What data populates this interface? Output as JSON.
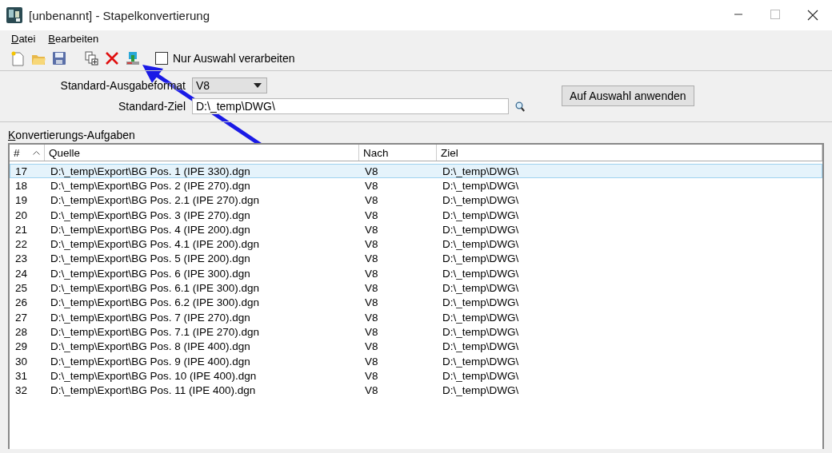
{
  "window": {
    "title": "[unbenannt] - Stapelkonvertierung"
  },
  "menu": [
    {
      "label": "Datei"
    },
    {
      "label": "Bearbeiten"
    }
  ],
  "toolbar": {
    "process_selection_only": {
      "label": "Nur Auswahl verarbeiten",
      "checked": false
    }
  },
  "settings": {
    "format_label": "Standard-Ausgabeformat",
    "format_value": "V8",
    "target_label": "Standard-Ziel",
    "target_value": "D:\\_temp\\DWG\\",
    "apply_button": "Auf Auswahl anwenden"
  },
  "tasks": {
    "title": "Konvertierungs-Aufgaben",
    "columns": [
      "#",
      "Quelle",
      "Nach",
      "Ziel"
    ],
    "rows": [
      {
        "cells": [
          "17",
          "D:\\_temp\\Export\\BG Pos. 1 (IPE 330).dgn",
          "V8",
          "D:\\_temp\\DWG\\"
        ],
        "selected": true
      },
      {
        "cells": [
          "18",
          "D:\\_temp\\Export\\BG Pos. 2 (IPE 270).dgn",
          "V8",
          "D:\\_temp\\DWG\\"
        ],
        "selected": false
      },
      {
        "cells": [
          "19",
          "D:\\_temp\\Export\\BG Pos. 2.1 (IPE 270).dgn",
          "V8",
          "D:\\_temp\\DWG\\"
        ],
        "selected": false
      },
      {
        "cells": [
          "20",
          "D:\\_temp\\Export\\BG Pos. 3 (IPE 270).dgn",
          "V8",
          "D:\\_temp\\DWG\\"
        ],
        "selected": false
      },
      {
        "cells": [
          "21",
          "D:\\_temp\\Export\\BG Pos. 4 (IPE 200).dgn",
          "V8",
          "D:\\_temp\\DWG\\"
        ],
        "selected": false
      },
      {
        "cells": [
          "22",
          "D:\\_temp\\Export\\BG Pos. 4.1 (IPE 200).dgn",
          "V8",
          "D:\\_temp\\DWG\\"
        ],
        "selected": false
      },
      {
        "cells": [
          "23",
          "D:\\_temp\\Export\\BG Pos. 5 (IPE 200).dgn",
          "V8",
          "D:\\_temp\\DWG\\"
        ],
        "selected": false
      },
      {
        "cells": [
          "24",
          "D:\\_temp\\Export\\BG Pos. 6 (IPE 300).dgn",
          "V8",
          "D:\\_temp\\DWG\\"
        ],
        "selected": false
      },
      {
        "cells": [
          "25",
          "D:\\_temp\\Export\\BG Pos. 6.1 (IPE 300).dgn",
          "V8",
          "D:\\_temp\\DWG\\"
        ],
        "selected": false
      },
      {
        "cells": [
          "26",
          "D:\\_temp\\Export\\BG Pos. 6.2 (IPE 300).dgn",
          "V8",
          "D:\\_temp\\DWG\\"
        ],
        "selected": false
      },
      {
        "cells": [
          "27",
          "D:\\_temp\\Export\\BG Pos. 7 (IPE 270).dgn",
          "V8",
          "D:\\_temp\\DWG\\"
        ],
        "selected": false
      },
      {
        "cells": [
          "28",
          "D:\\_temp\\Export\\BG Pos. 7.1 (IPE 270).dgn",
          "V8",
          "D:\\_temp\\DWG\\"
        ],
        "selected": false
      },
      {
        "cells": [
          "29",
          "D:\\_temp\\Export\\BG Pos. 8 (IPE 400).dgn",
          "V8",
          "D:\\_temp\\DWG\\"
        ],
        "selected": false
      },
      {
        "cells": [
          "30",
          "D:\\_temp\\Export\\BG Pos. 9 (IPE 400).dgn",
          "V8",
          "D:\\_temp\\DWG\\"
        ],
        "selected": false
      },
      {
        "cells": [
          "31",
          "D:\\_temp\\Export\\BG Pos. 10 (IPE 400).dgn",
          "V8",
          "D:\\_temp\\DWG\\"
        ],
        "selected": false
      },
      {
        "cells": [
          "32",
          "D:\\_temp\\Export\\BG Pos. 11 (IPE 400).dgn",
          "V8",
          "D:\\_temp\\DWG\\"
        ],
        "selected": false
      }
    ]
  }
}
